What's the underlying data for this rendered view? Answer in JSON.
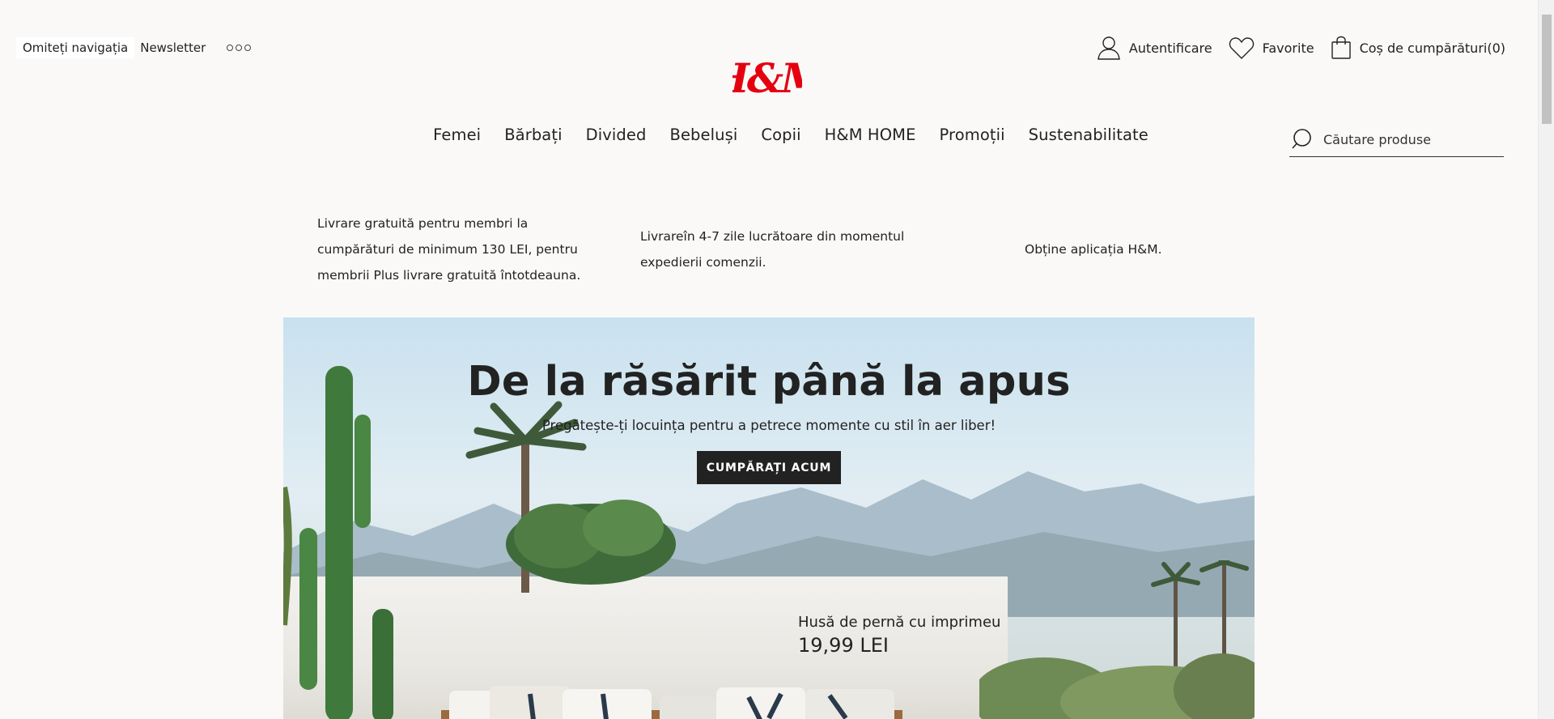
{
  "header": {
    "skip_nav": "Omiteți navigația",
    "newsletter": "Newsletter",
    "logo_text": "H&M",
    "account": [
      {
        "label": "Autentificare",
        "icon": "user-icon"
      },
      {
        "label": "Favorite",
        "icon": "heart-icon"
      },
      {
        "label": "Coș de cumpărături(0)",
        "icon": "shopping-bag-icon"
      }
    ]
  },
  "nav": {
    "items": [
      "Femei",
      "Bărbați",
      "Divided",
      "Bebeluși",
      "Copii",
      "H&M HOME",
      "Promoții",
      "Sustenabilitate"
    ]
  },
  "search": {
    "placeholder": "Căutare produse"
  },
  "usp": {
    "free_delivery": "Livrare gratuită pentru membri la cumpărături de minimum 130 LEI, pentru membrii Plus livrare gratuită întotdeauna.",
    "delivery_time": "Livrareîn 4-7 zile lucrătoare din momentul expedierii comenzii.",
    "app": "Obține aplicația H&M."
  },
  "hero": {
    "title": "De la răsărit până la apus",
    "subtitle": "Pregătește-ți locuința pentru a petrece momente cu stil în aer liber!",
    "cta": "CUMPĂRAȚI ACUM",
    "product_name": "Husă de pernă cu imprimeu",
    "product_price": "19,99 LEI"
  },
  "colors": {
    "brand_red": "#e50010",
    "text": "#222222",
    "background": "#faf9f8"
  }
}
